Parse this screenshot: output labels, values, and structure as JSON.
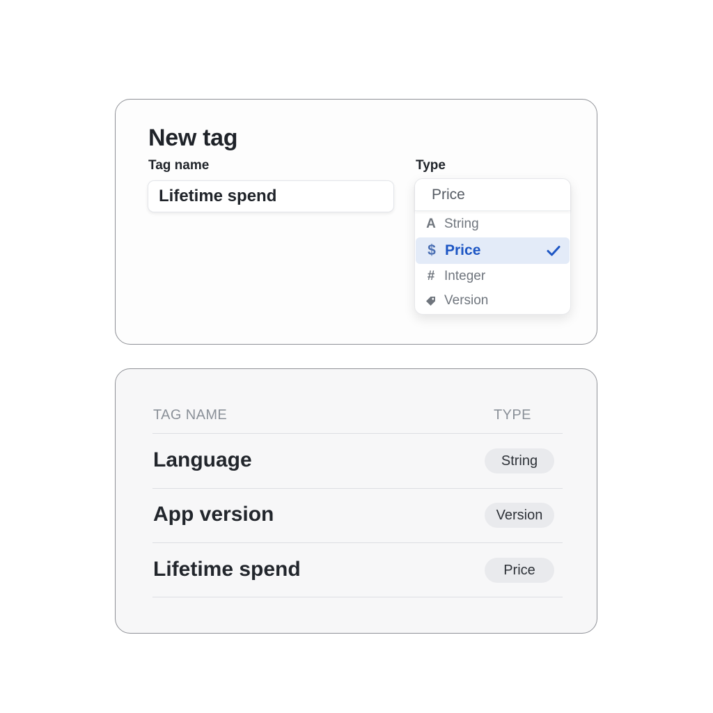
{
  "new_tag_form": {
    "title": "New tag",
    "tag_name_label": "Tag name",
    "tag_name_value": "Lifetime spend",
    "type_label": "Type",
    "type_selected": "Price",
    "type_options": [
      {
        "label": "String",
        "icon": "letter-a-icon"
      },
      {
        "label": "Price",
        "icon": "dollar-icon",
        "selected": true
      },
      {
        "label": "Integer",
        "icon": "hash-icon"
      },
      {
        "label": "Version",
        "icon": "tag-icon"
      }
    ]
  },
  "tags_table": {
    "columns": [
      "TAG NAME",
      "TYPE"
    ],
    "rows": [
      {
        "name": "Language",
        "type": "String"
      },
      {
        "name": "App version",
        "type": "Version"
      },
      {
        "name": "Lifetime spend",
        "type": "Price"
      }
    ]
  },
  "colors": {
    "accent": "#1d56c4",
    "selected_option_bg": "#e3ebf8",
    "badge_bg": "#e9eaed"
  }
}
